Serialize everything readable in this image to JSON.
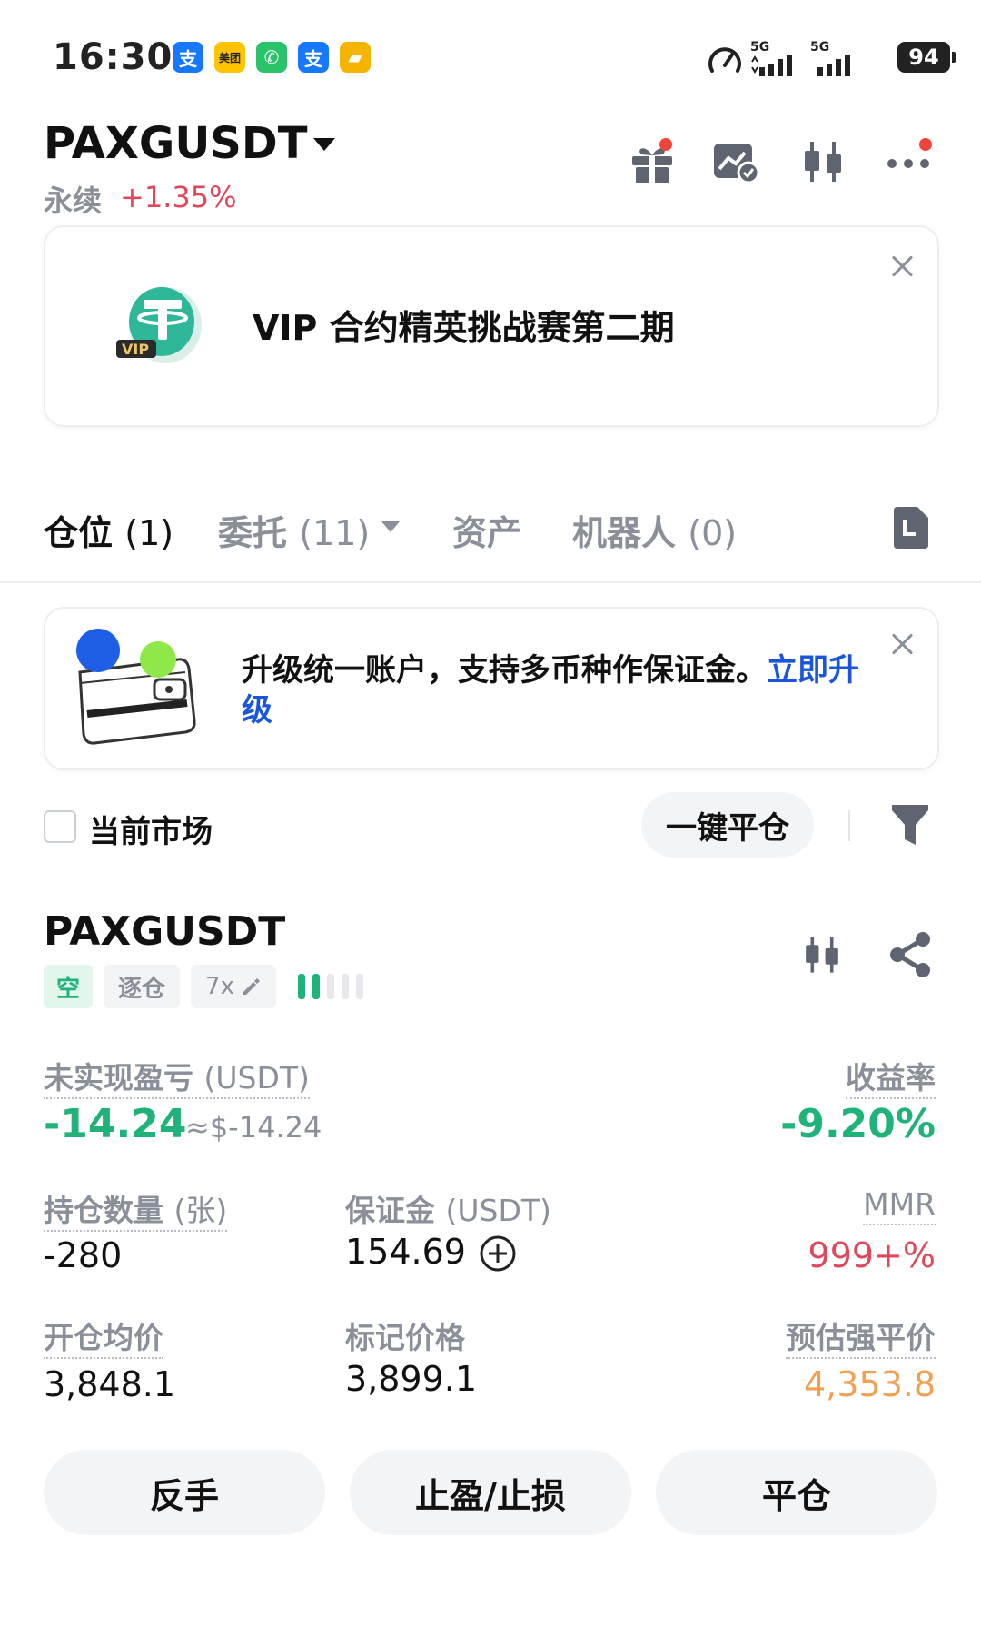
{
  "status_bar": {
    "time": "16:30",
    "apps": [
      {
        "icon": "alipay-icon",
        "glyph": "支",
        "color": "#1677ff"
      },
      {
        "icon": "meituan-icon",
        "glyph": "美团",
        "color": "#ffc300"
      },
      {
        "icon": "wechat-call-icon",
        "glyph": "✆",
        "color": "#2bc36a"
      },
      {
        "icon": "alipay-icon",
        "glyph": "支",
        "color": "#1677ff"
      },
      {
        "icon": "folder-app-icon",
        "glyph": "▰",
        "color": "#f4b400"
      }
    ],
    "network_1": "5G",
    "network_2": "5G",
    "battery": "94"
  },
  "header": {
    "symbol": "PAXGUSDT",
    "type": "永续",
    "change": "+1.35%",
    "icons": [
      "gift-icon",
      "chart-check-icon",
      "candlestick-icon",
      "more-icon"
    ]
  },
  "vip_banner": {
    "title": "VIP 合约精英挑战赛第二期",
    "badge_text": "VIP"
  },
  "tabs": [
    {
      "label": "仓位",
      "count": "(1)",
      "active": true
    },
    {
      "label": "委托",
      "count": "(11)",
      "active": false
    },
    {
      "label": "资产",
      "count": "",
      "active": false
    },
    {
      "label": "机器人",
      "count": "(0)",
      "active": false
    }
  ],
  "upgrade_banner": {
    "text": "升级统一账户，支持多币种作保证金。",
    "link": "立即升级"
  },
  "filter_row": {
    "checkbox_label": "当前市场",
    "close_all": "一键平仓"
  },
  "position": {
    "symbol": "PAXGUSDT",
    "side": "空",
    "margin_mode": "逐仓",
    "leverage": "7x",
    "risk_level_filled": 2,
    "risk_level_total": 5,
    "pnl_label": "未实现盈亏",
    "pnl_unit": "(USDT)",
    "pnl_value": "-14.24",
    "pnl_usd": "≈$-14.24",
    "roe_label": "收益率",
    "roe_value": "-9.20%",
    "size_label": "持仓数量",
    "size_unit": "(张)",
    "size_value": "-280",
    "margin_label": "保证金",
    "margin_unit": "(USDT)",
    "margin_value": "154.69",
    "mmr_label": "MMR",
    "mmr_value": "999+%",
    "entry_label": "开仓均价",
    "entry_value": "3,848.1",
    "mark_label": "标记价格",
    "mark_value": "3,899.1",
    "liq_label": "预估强平价",
    "liq_value": "4,353.8"
  },
  "actions": [
    "反手",
    "止盈/止损",
    "平仓"
  ],
  "colors": {
    "green": "#1fb37a",
    "red": "#e0475a",
    "orange": "#f0a050",
    "link": "#1a56db"
  }
}
